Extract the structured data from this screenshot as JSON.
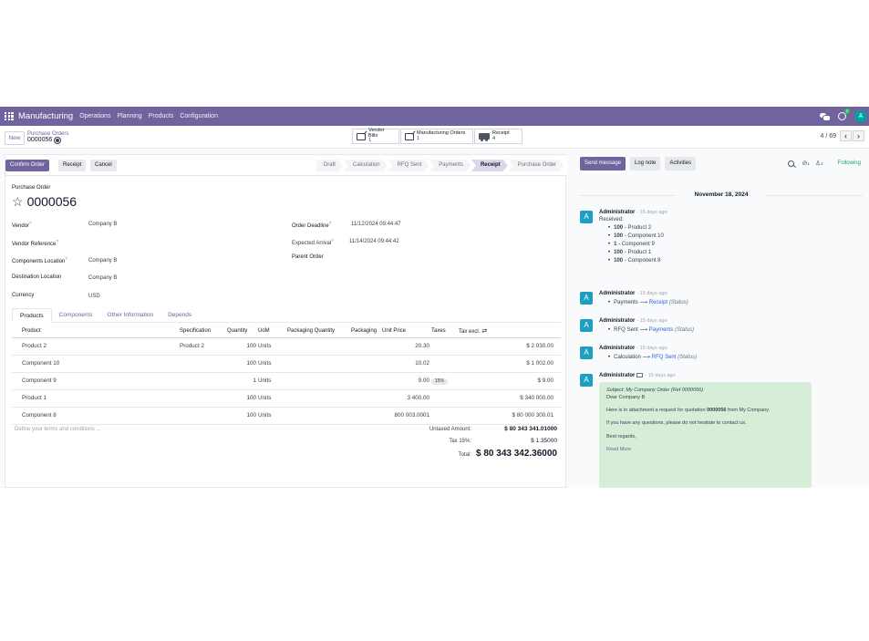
{
  "navbar": {
    "app_name": "Manufacturing",
    "menu": [
      "Operations",
      "Planning",
      "Products",
      "Configuration"
    ],
    "activity_count": "1",
    "user_initial": "A"
  },
  "control": {
    "new_label": "New",
    "breadcrumb_parent": "Purchase Orders",
    "breadcrumb_current": "0000056",
    "smart_buttons": [
      {
        "label": "Vendor Bills",
        "count": "1"
      },
      {
        "label": "Manufacturing Orders",
        "count": "1"
      },
      {
        "label": "Receipt",
        "count": "4"
      }
    ],
    "pager_value": "4 / 69",
    "prev": "‹",
    "next": "›"
  },
  "statusbar": {
    "confirm_label": "Confirm Order",
    "receipt_label": "Receipt",
    "cancel_label": "Cancel",
    "stages": [
      "Draft",
      "Calculation",
      "RFQ Sent",
      "Payments",
      "Receipt",
      "Purchase Order"
    ],
    "active_stage": "Receipt"
  },
  "form": {
    "header_label": "Purchase Order",
    "order_name": "0000056",
    "left_fields": [
      {
        "label": "Vendor",
        "help": "?",
        "value": "Company B"
      },
      {
        "label": "Vendor Reference",
        "help": "?",
        "value": ""
      },
      {
        "label": "Components Location",
        "help": "?",
        "value": "Company B"
      },
      {
        "label": "Destination Location",
        "help": "",
        "value": "Company B"
      },
      {
        "label": "Currency",
        "help": "",
        "value": "USD"
      }
    ],
    "right_fields": [
      {
        "label": "Order Deadline",
        "help": "?",
        "value": "11/12/2024 09:44:47"
      },
      {
        "label": "Expected Arrival",
        "help": "?",
        "value": "11/14/2024 09:44:42"
      },
      {
        "label": "Parent Order",
        "help": "",
        "value": ""
      }
    ],
    "tabs": [
      "Products",
      "Components",
      "Other Information",
      "Depends"
    ],
    "columns": [
      "Product",
      "Specification",
      "Quantity",
      "UoM",
      "Packaging Quantity",
      "Packaging",
      "Unit Price",
      "Taxes",
      "Tax excl."
    ],
    "rows": [
      {
        "product": "Product 2",
        "spec": "Product 2",
        "qty": "100",
        "uom": "Units",
        "price": "20.30",
        "taxes": "",
        "subtotal": "$ 2 030.00"
      },
      {
        "product": "Component 10",
        "spec": "",
        "qty": "100",
        "uom": "Units",
        "price": "10.02",
        "taxes": "",
        "subtotal": "$ 1 002.00"
      },
      {
        "product": "Component 9",
        "spec": "",
        "qty": "1",
        "uom": "Units",
        "price": "9.00",
        "taxes": "15%",
        "subtotal": "$ 9.00"
      },
      {
        "product": "Product 1",
        "spec": "",
        "qty": "100",
        "uom": "Units",
        "price": "3 400.00",
        "taxes": "",
        "subtotal": "$ 340 000.00"
      },
      {
        "product": "Component 8",
        "spec": "",
        "qty": "100",
        "uom": "Units",
        "price": "800 003.0001",
        "taxes": "",
        "subtotal": "$ 80 000 300.01"
      }
    ],
    "terms_placeholder": "Define your terms and conditions ...",
    "untaxed_label": "Untaxed Amount:",
    "untaxed_value": "$ 80 343 341.01000",
    "tax_label": "Tax 15%:",
    "tax_value": "$ 1.35000",
    "total_label": "Total:",
    "total_value": "$ 80 343 342.36000"
  },
  "chatter": {
    "send_message": "Send message",
    "log_note": "Log note",
    "activities": "Activities",
    "attachments_count": "1",
    "followers_count": "2",
    "following": "Following",
    "date": "November 18, 2024",
    "messages": [
      {
        "author": "Administrator",
        "ago": "- 15 days ago",
        "text": "Received:",
        "items": [
          {
            "qty": "100",
            "name": "Product 2"
          },
          {
            "qty": "100",
            "name": "Component 10"
          },
          {
            "qty": "1",
            "name": "Component 9"
          },
          {
            "qty": "100",
            "name": "Product 1"
          },
          {
            "qty": "100",
            "name": "Component 8"
          }
        ]
      },
      {
        "author": "Administrator",
        "ago": "- 15 days ago",
        "old": "Payments",
        "new": "Receipt",
        "field": "(Status)"
      },
      {
        "author": "Administrator",
        "ago": "- 15 days ago",
        "old": "RFQ Sent",
        "new": "Payments",
        "field": "(Status)"
      },
      {
        "author": "Administrator",
        "ago": "- 15 days ago",
        "old": "Calculation",
        "new": "RFQ Sent",
        "field": "(Status)"
      },
      {
        "author": "Administrator",
        "ago": "- 15 days ago"
      }
    ],
    "mail": {
      "subject": "Subject: My Company Order (Ref 0000056)",
      "greeting": "Dear Company B",
      "body_before": "Here is in attachment a request for quotation ",
      "body_bold": "0000056",
      "body_after": " from My Company.",
      "question": "If you have any questions, please do not hesitate to contact us.",
      "regards": "Best regards,",
      "read_more": "Read More"
    }
  },
  "colors": {
    "brand": "#71639e",
    "avatar": "#1f9fbf",
    "following": "#22a06b",
    "mail_bg": "#d6eed8"
  }
}
